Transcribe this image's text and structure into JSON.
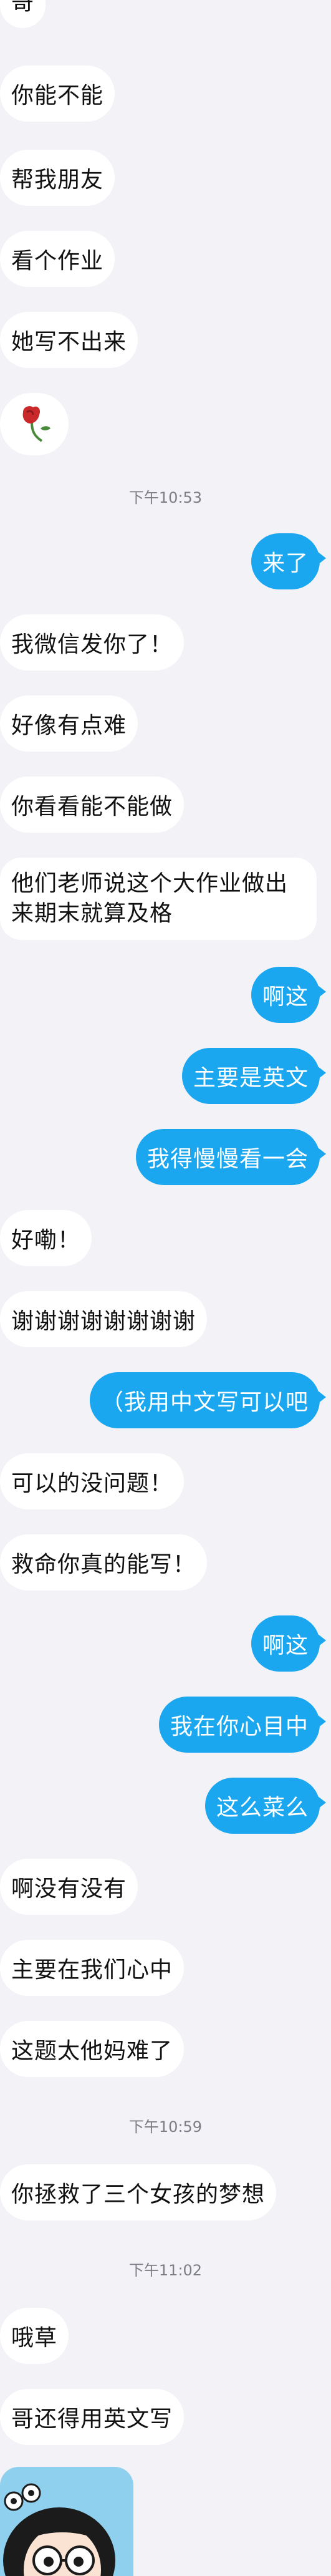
{
  "messages": [
    {
      "side": "left",
      "text": "哥"
    },
    {
      "side": "left",
      "text": "你能不能"
    },
    {
      "side": "left",
      "text": "帮我朋友"
    },
    {
      "side": "left",
      "text": "看个作业"
    },
    {
      "side": "left",
      "text": "她写不出来"
    },
    {
      "side": "left",
      "sticker": "rose-icon"
    },
    {
      "timestamp": "下午10:53"
    },
    {
      "side": "right",
      "text": "来了"
    },
    {
      "side": "left",
      "text": "我微信发你了！"
    },
    {
      "side": "left",
      "text": "好像有点难"
    },
    {
      "side": "left",
      "text": "你看看能不能做"
    },
    {
      "side": "left",
      "text": "他们老师说这个大作业做出来期末就算及格"
    },
    {
      "side": "right",
      "text": "啊这"
    },
    {
      "side": "right",
      "text": "主要是英文"
    },
    {
      "side": "right",
      "text": "我得慢慢看一会"
    },
    {
      "side": "left",
      "text": "好嘞！"
    },
    {
      "side": "left",
      "text": "谢谢谢谢谢谢谢谢"
    },
    {
      "side": "right",
      "text": "（我用中文写可以吧"
    },
    {
      "side": "left",
      "text": "可以的没问题！"
    },
    {
      "side": "left",
      "text": "救命你真的能写！"
    },
    {
      "side": "right",
      "text": "啊这"
    },
    {
      "side": "right",
      "text": "我在你心目中"
    },
    {
      "side": "right",
      "text": "这么菜么"
    },
    {
      "side": "left",
      "text": "啊没有没有"
    },
    {
      "side": "left",
      "text": "主要在我们心中"
    },
    {
      "side": "left",
      "text": "这题太他妈难了"
    },
    {
      "timestamp": "下午10:59"
    },
    {
      "side": "left",
      "text": "你拯救了三个女孩的梦想"
    },
    {
      "timestamp": "下午11:02"
    },
    {
      "side": "left",
      "text": "哦草"
    },
    {
      "side": "left",
      "text": "哥还得用英文写"
    }
  ],
  "colors": {
    "background": "#f2f2f7",
    "sent_bubble": "#1aa7f0",
    "received_bubble": "#ffffff"
  }
}
